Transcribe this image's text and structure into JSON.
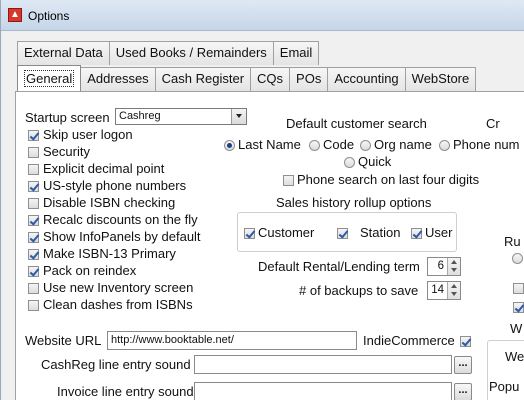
{
  "window": {
    "title": "Options"
  },
  "tabs_top": [
    "External Data",
    "Used Books / Remainders",
    "Email"
  ],
  "tabs_bottom": [
    {
      "label": "General",
      "active": true
    },
    {
      "label": "Addresses"
    },
    {
      "label": "Cash Register"
    },
    {
      "label": "CQs"
    },
    {
      "label": "POs"
    },
    {
      "label": "Accounting"
    },
    {
      "label": "WebStore"
    }
  ],
  "startup": {
    "label": "Startup screen",
    "value": "Cashreg"
  },
  "checkboxes": [
    {
      "label": "Skip user logon",
      "checked": true
    },
    {
      "label": "Security",
      "checked": false
    },
    {
      "label": "Explicit decimal point",
      "checked": false
    },
    {
      "label": "US-style phone numbers",
      "checked": true
    },
    {
      "label": "Disable ISBN checking",
      "checked": false
    },
    {
      "label": "Recalc discounts on the fly",
      "checked": true
    },
    {
      "label": "Show InfoPanels by default",
      "checked": true
    },
    {
      "label": "Make ISBN-13 Primary",
      "checked": true
    },
    {
      "label": "Pack on reindex",
      "checked": true
    },
    {
      "label": "Use new Inventory screen",
      "checked": false
    },
    {
      "label": "Clean dashes from ISBNs",
      "checked": false
    }
  ],
  "customer_search": {
    "label": "Default customer search",
    "options": [
      "Last Name",
      "Code",
      "Org name",
      "Phone num",
      "Quick"
    ],
    "selected": "Last Name",
    "phone_last_four": {
      "label": "Phone search on last four digits",
      "checked": false
    }
  },
  "rollup": {
    "label": "Sales history rollup options",
    "options": [
      {
        "label": "Customer",
        "checked": true
      },
      {
        "label": "Station",
        "checked": true
      },
      {
        "label": "User",
        "checked": true
      }
    ]
  },
  "rental_term": {
    "label": "Default Rental/Lending term",
    "value": "6"
  },
  "backups": {
    "label": "# of backups to save",
    "value": "14"
  },
  "website": {
    "label": "Website URL",
    "value": "http://www.booktable.net/"
  },
  "indie": {
    "label": "IndieCommerce",
    "checked": true
  },
  "cashreg_sound": {
    "label": "CashReg line entry sound",
    "value": ""
  },
  "invoice_sound": {
    "label": "Invoice line entry sound",
    "value": ""
  },
  "browse_label": "...",
  "right_cut": {
    "c1": "Cr",
    "r1": "Ru",
    "w1": "W",
    "we": "We",
    "popu": "Popu"
  }
}
